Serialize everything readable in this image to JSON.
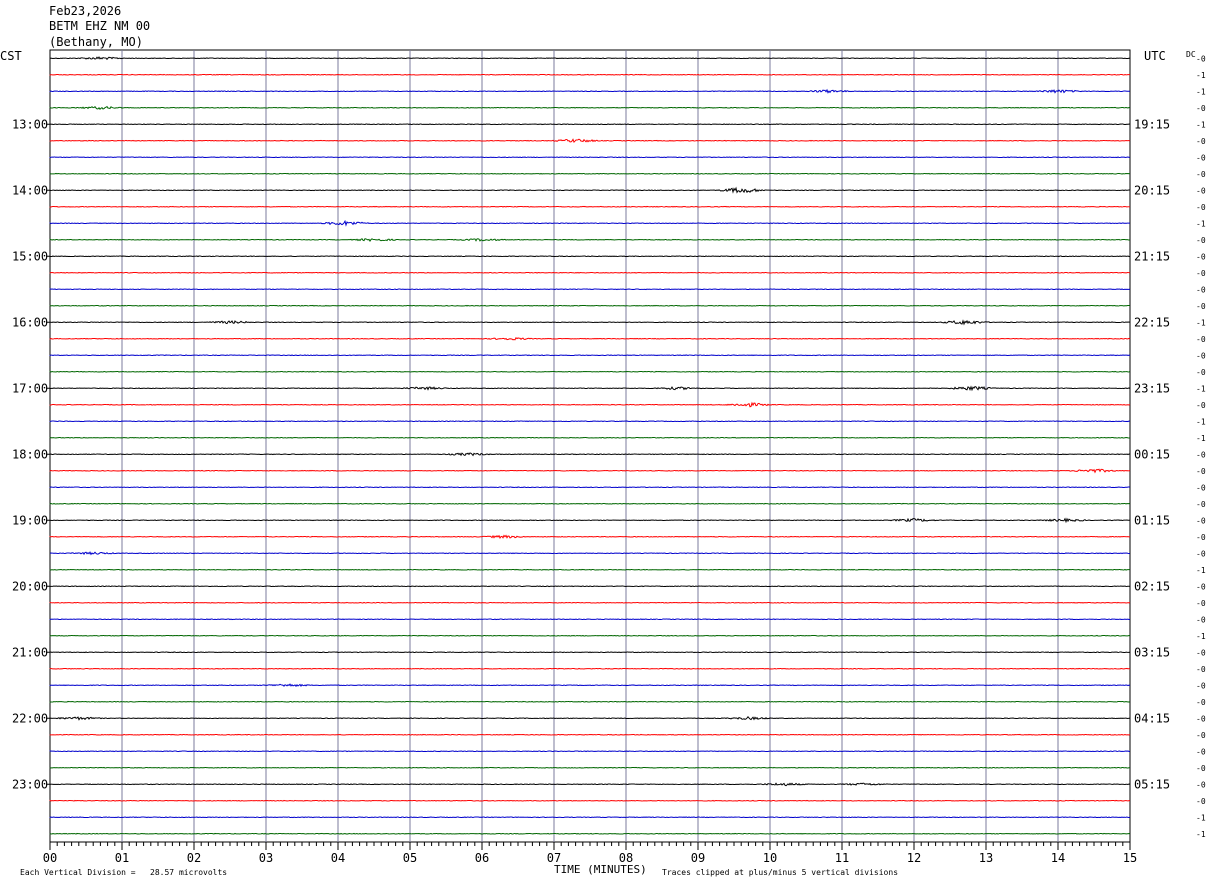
{
  "header": {
    "date": "Feb23,2026",
    "station": "BETM EHZ NM 00",
    "location": "(Bethany, MO)"
  },
  "left_axis_title": "CST",
  "right_axis_title": "UTC",
  "dc_label": "DC",
  "left_hour_labels": [
    "13:00",
    "14:00",
    "15:00",
    "16:00",
    "17:00",
    "18:00",
    "19:00",
    "20:00",
    "21:00",
    "22:00",
    "23:00"
  ],
  "right_hour_labels": [
    "19:15",
    "20:15",
    "21:15",
    "22:15",
    "23:15",
    "00:15",
    "01:15",
    "02:15",
    "03:15",
    "04:15",
    "05:15"
  ],
  "x_tick_labels": [
    "00",
    "01",
    "02",
    "03",
    "04",
    "05",
    "06",
    "07",
    "08",
    "09",
    "10",
    "11",
    "12",
    "13",
    "14",
    "15"
  ],
  "footer": {
    "scale_note": "Each Vertical Division =   28.57 microvolts",
    "xlabel": "TIME (MINUTES)",
    "clip_note": "Traces clipped at plus/minus 5 vertical divisions"
  },
  "chart_data": {
    "type": "line",
    "title": "",
    "xlabel": "TIME (MINUTES)",
    "xlim": [
      0,
      15
    ],
    "trace_count": 48,
    "minutes_per_trace": 15,
    "trace_colors": [
      "#000000",
      "#ff0000",
      "#0000cc",
      "#006600"
    ],
    "grid": true,
    "dc_offsets": [
      "-0",
      "-1",
      "-1",
      "-0",
      "-1",
      "-0",
      "-0",
      "-0",
      "-0",
      "-0",
      "-1",
      "-0",
      "-0",
      "-0",
      "-0",
      "-0",
      "-1",
      "-0",
      "-0",
      "-0",
      "-1",
      "-0",
      "-1",
      "-1",
      "-0",
      "-0",
      "-0",
      "-0",
      "-0",
      "-0",
      "-0",
      "-1",
      "-0",
      "-0",
      "-0",
      "-1",
      "-0",
      "-0",
      "-0",
      "-0",
      "-0",
      "-0",
      "-0",
      "-0",
      "-0",
      "-0",
      "-1",
      "-1"
    ],
    "events": [
      {
        "trace": 0,
        "minute": 0.7,
        "amp": 0.6
      },
      {
        "trace": 2,
        "minute": 10.8,
        "amp": 0.6
      },
      {
        "trace": 2,
        "minute": 14.0,
        "amp": 0.7
      },
      {
        "trace": 3,
        "minute": 0.7,
        "amp": 0.6
      },
      {
        "trace": 5,
        "minute": 7.3,
        "amp": 0.8
      },
      {
        "trace": 8,
        "minute": 9.6,
        "amp": 1.3
      },
      {
        "trace": 10,
        "minute": 4.1,
        "amp": 1.0
      },
      {
        "trace": 11,
        "minute": 4.5,
        "amp": 0.6
      },
      {
        "trace": 11,
        "minute": 6.0,
        "amp": 0.5
      },
      {
        "trace": 16,
        "minute": 2.5,
        "amp": 0.6
      },
      {
        "trace": 16,
        "minute": 12.7,
        "amp": 1.0
      },
      {
        "trace": 17,
        "minute": 6.4,
        "amp": 0.5
      },
      {
        "trace": 20,
        "minute": 5.2,
        "amp": 0.6
      },
      {
        "trace": 20,
        "minute": 8.7,
        "amp": 0.6
      },
      {
        "trace": 20,
        "minute": 12.8,
        "amp": 0.9
      },
      {
        "trace": 21,
        "minute": 9.7,
        "amp": 0.9
      },
      {
        "trace": 24,
        "minute": 5.8,
        "amp": 0.6
      },
      {
        "trace": 25,
        "minute": 14.5,
        "amp": 0.8
      },
      {
        "trace": 28,
        "minute": 12.0,
        "amp": 0.7
      },
      {
        "trace": 28,
        "minute": 14.1,
        "amp": 0.6
      },
      {
        "trace": 29,
        "minute": 6.3,
        "amp": 0.6
      },
      {
        "trace": 30,
        "minute": 0.6,
        "amp": 0.5
      },
      {
        "trace": 38,
        "minute": 3.3,
        "amp": 0.6
      },
      {
        "trace": 40,
        "minute": 0.4,
        "amp": 0.6
      },
      {
        "trace": 40,
        "minute": 9.7,
        "amp": 0.6
      },
      {
        "trace": 44,
        "minute": 10.2,
        "amp": 0.6
      },
      {
        "trace": 44,
        "minute": 11.3,
        "amp": 0.5
      }
    ]
  }
}
